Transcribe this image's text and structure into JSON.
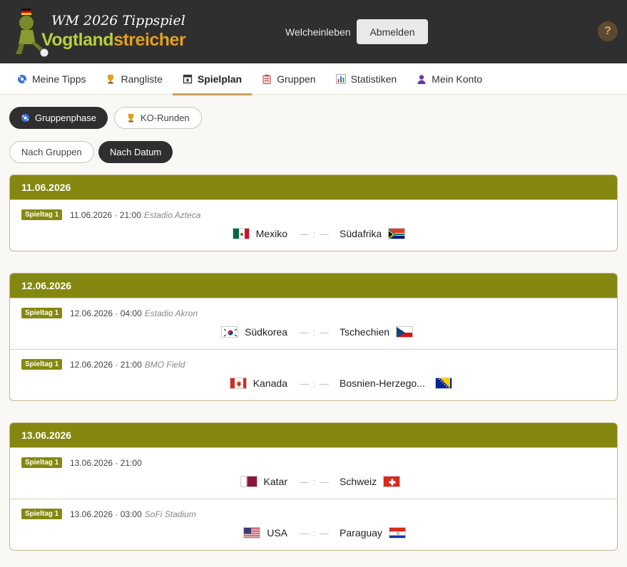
{
  "header": {
    "title": "WM 2026 Tippspiel",
    "brand_part1": "Vogtland",
    "brand_part2": "streicher",
    "user": "Welcheinleben",
    "logout_label": "Abmelden",
    "help_label": "?"
  },
  "nav": {
    "tabs": [
      {
        "label": "Meine Tipps",
        "icon": "soccer-ball-icon"
      },
      {
        "label": "Rangliste",
        "icon": "trophy-icon"
      },
      {
        "label": "Spielplan",
        "icon": "calendar-icon",
        "active": true
      },
      {
        "label": "Gruppen",
        "icon": "clipboard-icon"
      },
      {
        "label": "Statistiken",
        "icon": "bar-chart-icon"
      },
      {
        "label": "Mein Konto",
        "icon": "user-icon"
      }
    ]
  },
  "phase": {
    "group_label": "Gruppenphase",
    "ko_label": "KO-Runden"
  },
  "view": {
    "by_group_label": "Nach Gruppen",
    "by_date_label": "Nach Datum"
  },
  "days": [
    {
      "date": "11.06.2026",
      "matches": [
        {
          "badge": "Spieltag 1",
          "datetime": "11.06.2026 · 21:00",
          "venue": "Estadio Azteca",
          "home": "Mexiko",
          "away": "Südafrika",
          "score": "— : —"
        }
      ]
    },
    {
      "date": "12.06.2026",
      "matches": [
        {
          "badge": "Spieltag 1",
          "datetime": "12.06.2026 · 04:00",
          "venue": "Estadio Akron",
          "home": "Südkorea",
          "away": "Tschechien",
          "score": "— : —"
        },
        {
          "badge": "Spieltag 1",
          "datetime": "12.06.2026 · 21:00",
          "venue": "BMO Field",
          "home": "Kanada",
          "away": "Bosnien-Herzego...",
          "score": "— : —"
        }
      ]
    },
    {
      "date": "13.06.2026",
      "matches": [
        {
          "badge": "Spieltag 1",
          "datetime": "13.06.2026 · 21:00",
          "venue": "",
          "home": "Katar",
          "away": "Schweiz",
          "score": "— : —"
        },
        {
          "badge": "Spieltag 1",
          "datetime": "13.06.2026 · 03:00",
          "venue": "SoFi Stadium",
          "home": "USA",
          "away": "Paraguay",
          "score": "— : —"
        }
      ]
    }
  ]
}
